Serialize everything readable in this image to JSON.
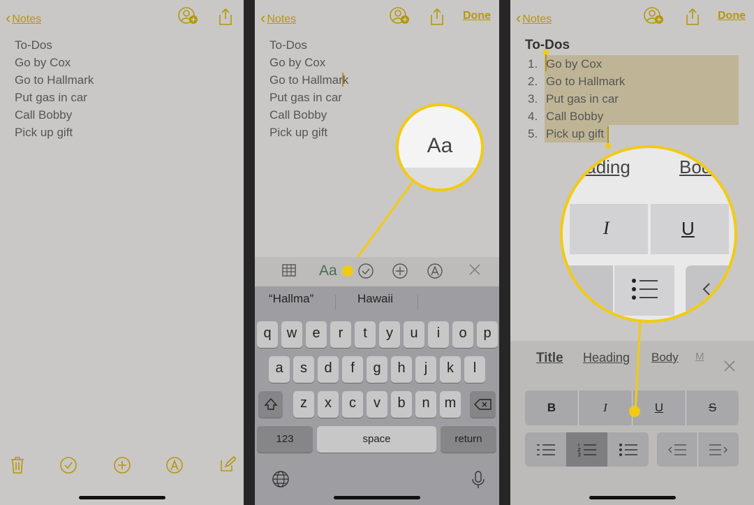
{
  "nav": {
    "back_label": "Notes",
    "done_label": "Done"
  },
  "note": {
    "title": "To-Dos",
    "items": [
      "Go by Cox",
      "Go to Hallmark",
      "Put gas in car",
      "Call Bobby",
      "Pick up gift"
    ]
  },
  "numbered_list": {
    "markers": [
      "1.",
      "2.",
      "3.",
      "4.",
      "5."
    ]
  },
  "toolbar": {
    "format_label": "Aa"
  },
  "magnifier_format": {
    "label": "Aa"
  },
  "keyboard": {
    "suggestions": [
      "“Hallma”",
      "Hawaii"
    ],
    "row1": [
      "q",
      "w",
      "e",
      "r",
      "t",
      "y",
      "u",
      "i",
      "o",
      "p"
    ],
    "row2": [
      "a",
      "s",
      "d",
      "f",
      "g",
      "h",
      "j",
      "k",
      "l"
    ],
    "row3": [
      "z",
      "x",
      "c",
      "v",
      "b",
      "n",
      "m"
    ],
    "numbers_label": "123",
    "space_label": "space",
    "return_label": "return"
  },
  "format_panel": {
    "styles": [
      "Title",
      "Heading",
      "Body",
      "M"
    ],
    "bold": "B",
    "italic": "I",
    "underline": "U",
    "strike": "S"
  },
  "magnifier_styles": {
    "heading": "Heading",
    "body": "Bod",
    "italic": "I",
    "underline": "U"
  },
  "colors": {
    "accent": "#b6960c",
    "highlight": "#f2ca12",
    "background": "#c9c8c6"
  }
}
